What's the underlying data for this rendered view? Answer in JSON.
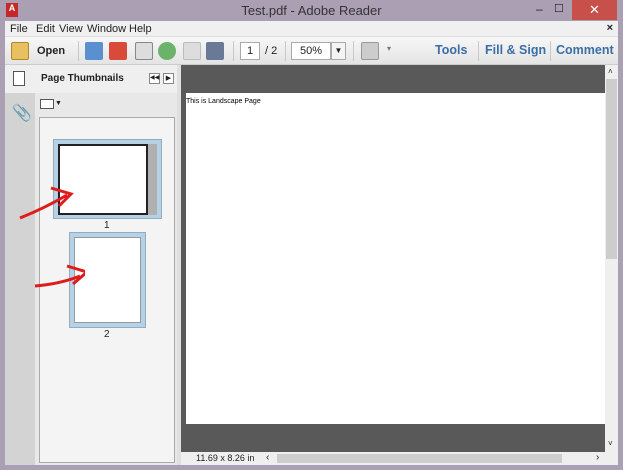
{
  "window": {
    "title": "Test.pdf - Adobe Reader",
    "minimize": "–",
    "maximize": "☐",
    "close": "✕"
  },
  "menu": [
    "File",
    "Edit",
    "View",
    "Window",
    "Help"
  ],
  "menu_close": "×",
  "toolbar": {
    "open_label": "Open",
    "page_current": "1",
    "page_total": "/ 2",
    "zoom": "50%",
    "tools": "Tools",
    "fill_sign": "Fill & Sign",
    "comment": "Comment"
  },
  "panel": {
    "title": "Page Thumbnails",
    "thumbs": [
      {
        "label": "1",
        "selected": true,
        "orientation": "landscape"
      },
      {
        "label": "2",
        "selected": false,
        "orientation": "portrait"
      }
    ]
  },
  "document": {
    "text": "This is Landscape Page"
  },
  "status": {
    "page_size": "11.69 x 8.26 in"
  },
  "annotations": {
    "arrow_color": "#e01b1b"
  }
}
